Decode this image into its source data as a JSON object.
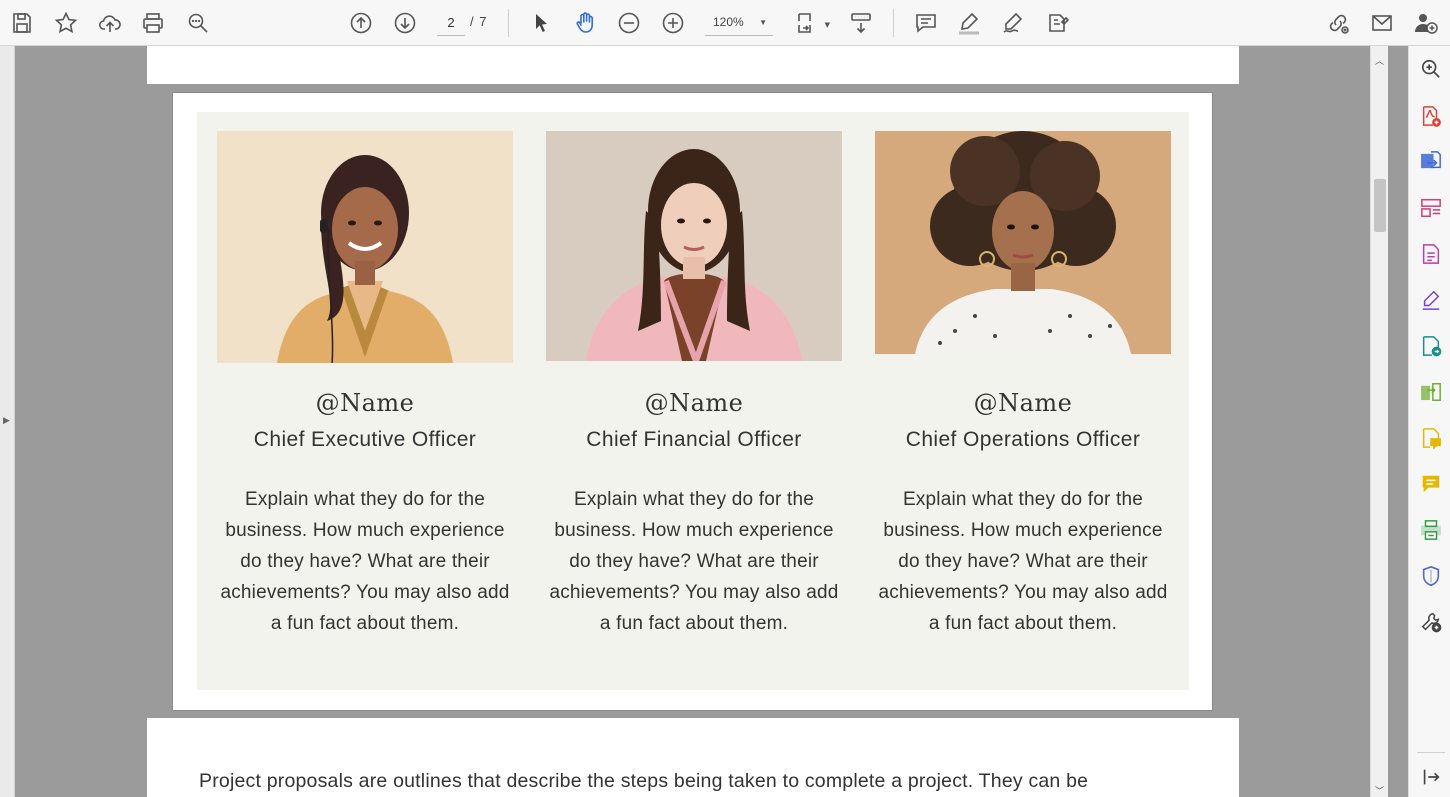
{
  "toolbar": {
    "icons": [
      "save-icon",
      "bookmark-star-icon",
      "upload-cloud-icon",
      "print-icon",
      "search-zoom-icon",
      "previous-page-icon",
      "next-page-icon",
      "select-cursor-icon",
      "hand-tool-icon",
      "zoom-out-icon",
      "zoom-in-icon",
      "fit-page-icon",
      "scrolling-mode-icon",
      "comment-icon",
      "highlight-pen-icon",
      "draw-signature-icon",
      "fill-sign-icon",
      "share-link-icon",
      "email-icon",
      "add-user-icon"
    ],
    "page_current": "2",
    "page_total": "/ 7",
    "zoom": "120%"
  },
  "document": {
    "team": [
      {
        "name": "@Name",
        "role": "Chief Executive Officer",
        "description": "Explain what they do for the business. How much experience do they have? What are their achievements? You may also add a fun fact about them."
      },
      {
        "name": "@Name",
        "role": "Chief Financial Officer",
        "description": "Explain what they do for the business. How much experience do they have? What are their achievements? You may also add a fun fact about them."
      },
      {
        "name": "@Name",
        "role": "Chief Operations Officer",
        "description": "Explain what they do for the business. How much experience do they have? What are their achievements? You may also add a fun fact about them."
      }
    ],
    "next_page_text": "Project proposals are outlines that describe the steps being taken to complete a project. They can be"
  },
  "right_pane": {
    "icons": [
      "zoom-search-icon",
      "create-pdf-icon",
      "export-pdf-icon",
      "organize-pages-icon",
      "edit-pdf-icon",
      "fill-sign-icon",
      "send-for-review-icon",
      "compare-files-icon",
      "comment-notes-icon",
      "comment-icon",
      "print-production-icon",
      "protect-shield-icon",
      "more-tools-icon",
      "expand-pane-icon"
    ]
  },
  "colors": {
    "accent_blue": "#2f6ddc",
    "panel_bg": "#f3f3ee",
    "canvas_gray": "#9b9b9b"
  }
}
